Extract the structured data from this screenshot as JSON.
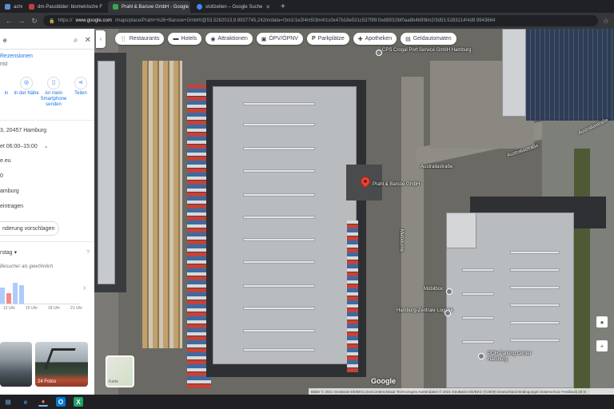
{
  "browser": {
    "tabs": [
      {
        "title": "achricht",
        "favicon_color": "#5f8ecf",
        "active": false
      },
      {
        "title": "dm-Passbilder: biometrische F",
        "favicon_color": "#c63d3d",
        "active": false
      },
      {
        "title": "Prahl & Barsoe GmbH - Google",
        "favicon_color": "#34a853",
        "active": true
      },
      {
        "title": "stollzeiten – Google Suche",
        "favicon_color": "#4285f4",
        "active": false
      }
    ],
    "new_tab": "+",
    "url_host": "www.google.com",
    "url_prefix": "https://",
    "url_rest": "/maps/place/Prahl+%26+Barsoe+GmbH/@53.5282013,9.9937745,242m/data=!3m1!1e3!4m5!3m4!1s0x47b18e531c537f99:0xd85f10bf0aa8b4b9!8m2!3d53.5283214!4d9.9943664"
  },
  "panel": {
    "search_value": "e",
    "reviews_link": "Rezensionen",
    "category": "nst",
    "actions": [
      {
        "label": "in",
        "icon": "route-icon"
      },
      {
        "label": "In der Nähe",
        "icon": "nearby-icon"
      },
      {
        "label": "An mein Smartphone senden",
        "icon": "phone-icon"
      },
      {
        "label": "Teilen",
        "icon": "share-icon"
      }
    ],
    "address": "3, 20457 Hamburg",
    "hours": "et  06:00–15:00",
    "website": "e.eu",
    "phone": "0",
    "plus_code": "amburg",
    "add_label": "eintragen",
    "suggest_button": "nderung vorschlagen",
    "busy_day": "rstag",
    "busy_note": "Besucher als gewöhnlich",
    "busy_values": [
      0.55,
      0.35,
      0.72,
      0.65
    ],
    "hour_labels": [
      "12 Uhr",
      "15 Uhr",
      "18 Uhr",
      "21 Uhr"
    ],
    "photo_count": "24 Fotos"
  },
  "map": {
    "chips": [
      {
        "label": "Restaurants",
        "icon": "restaurant-icon"
      },
      {
        "label": "Hotels",
        "icon": "hotel-icon"
      },
      {
        "label": "Attraktionen",
        "icon": "attraction-icon"
      },
      {
        "label": "ÖPV/ÖPNV",
        "icon": "transit-icon"
      },
      {
        "label": "Parkplätze",
        "icon": "parking-icon"
      },
      {
        "label": "Apotheken",
        "icon": "pharmacy-icon"
      },
      {
        "label": "Geldautomaten",
        "icon": "atm-icon"
      }
    ],
    "place_label": "Prahl & Barsoe GmbH",
    "poi_labels": [
      "CPS Crogal Port Service GmbH Hamburg",
      "Mobilbox",
      "Hamburg-Zentrale Logistik",
      "POH Parking Center Hamburg"
    ],
    "street_labels": [
      "Australiastraße",
      "Australiastraße",
      "Australiastraße",
      "Melbourne"
    ],
    "layer_label": "Karte",
    "logo": "Google",
    "attribution": "Bilder © 2021 GeoBasis-DE/BKG,GeoContent,Maxar Technologies,Kartendaten © 2021 GeoBasis-DE/BKG (©2009)  Deutschland  Bedingungen  Datenschutz  Feedback  20 m"
  },
  "taskbar": {
    "apps": [
      {
        "name": "start",
        "color": "#76b9ed",
        "glyph": "⊞"
      },
      {
        "name": "edge",
        "color": "#3a96dd",
        "glyph": "e"
      },
      {
        "name": "firefox",
        "color": "#ff7139",
        "glyph": "●"
      },
      {
        "name": "outlook",
        "color": "#0078d4",
        "glyph": "O"
      },
      {
        "name": "excel",
        "color": "#21a366",
        "glyph": "X"
      }
    ]
  }
}
